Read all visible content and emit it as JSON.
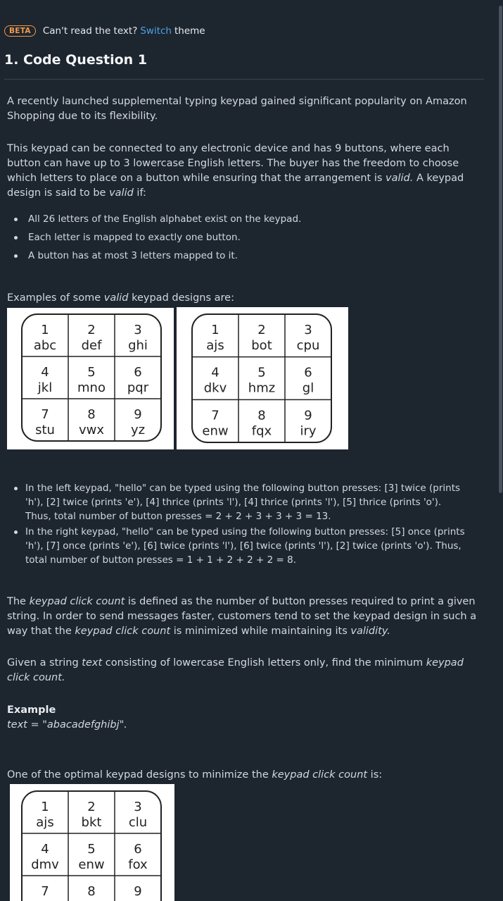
{
  "banner": {
    "badge": "BETA",
    "text_before": "Can't read the text?",
    "link": "Switch",
    "text_after": "theme"
  },
  "title": "1. Code Question 1",
  "intro": "A recently launched supplemental typing keypad gained significant popularity on Amazon Shopping due to its flexibility.",
  "desc": {
    "p1": "This keypad can be connected to any electronic device and has 9 buttons, where each button can have up to 3 lowercase English letters. The buyer has the freedom to choose which letters to place on a button while ensuring that the arrangement is ",
    "valid1": "valid.",
    "p2": " A keypad design is said to be ",
    "valid2": "valid",
    "p3": " if:"
  },
  "rules": [
    "All 26 letters of the English alphabet exist on the keypad.",
    "Each letter is mapped to exactly one button.",
    "A button has at most 3 letters mapped to it."
  ],
  "examples_heading": {
    "pre": "Examples of some ",
    "em": "valid",
    "post": " keypad designs are:"
  },
  "keypads": {
    "left": [
      [
        "1",
        "abc"
      ],
      [
        "2",
        "def"
      ],
      [
        "3",
        "ghi"
      ],
      [
        "4",
        "jkl"
      ],
      [
        "5",
        "mno"
      ],
      [
        "6",
        "pqr"
      ],
      [
        "7",
        "stu"
      ],
      [
        "8",
        "vwx"
      ],
      [
        "9",
        "yz"
      ]
    ],
    "right": [
      [
        "1",
        "ajs"
      ],
      [
        "2",
        "bot"
      ],
      [
        "3",
        "cpu"
      ],
      [
        "4",
        "dkv"
      ],
      [
        "5",
        "hmz"
      ],
      [
        "6",
        "gl"
      ],
      [
        "7",
        "enw"
      ],
      [
        "8",
        "fqx"
      ],
      [
        "9",
        "iry"
      ]
    ],
    "optimal": [
      [
        "1",
        "ajs"
      ],
      [
        "2",
        "bkt"
      ],
      [
        "3",
        "clu"
      ],
      [
        "4",
        "dmv"
      ],
      [
        "5",
        "enw"
      ],
      [
        "6",
        "fox"
      ],
      [
        "7",
        ""
      ],
      [
        "8",
        ""
      ],
      [
        "9",
        ""
      ]
    ]
  },
  "explanations": [
    "In the left keypad, \"hello\" can be typed using the following button presses: [3] twice (prints 'h'), [2] twice (prints 'e'), [4] thrice (prints 'l'), [4] thrice (prints 'l'), [5] thrice (prints 'o'). Thus, total number of button presses = 2 + 2 + 3 + 3 + 3 = 13.",
    "In the right keypad, \"hello\" can be typed using the following button presses: [5] once (prints 'h'), [7] once (prints 'e'), [6] twice (prints 'l'), [6] twice (prints 'l'), [2] twice (prints 'o'). Thus, total number of button presses = 1 + 1 + 2 + 2 + 2 = 8."
  ],
  "click_count": {
    "a": "The ",
    "b": "keypad click count",
    "c": " is defined as the number of button presses required to print a given string. In order to send messages faster, customers tend to set the keypad design in such a way that the ",
    "d": "keypad click count",
    "e": " is minimized while maintaining its ",
    "f": "validity."
  },
  "given": {
    "a": "Given a string ",
    "b": "text",
    "c": " consisting of lowercase English letters only, find the minimum ",
    "d": "keypad click count."
  },
  "example": {
    "label": "Example",
    "text": "text = \"abacadefghibj\"."
  },
  "optimal_heading": {
    "a": "One of the optimal keypad designs to minimize the ",
    "b": "keypad click count",
    "c": " is:"
  }
}
